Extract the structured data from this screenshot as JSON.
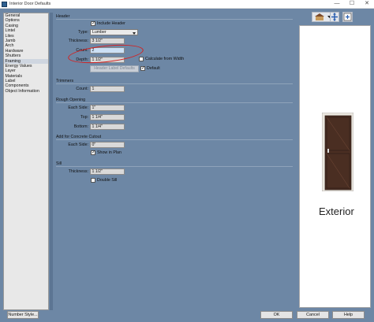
{
  "window": {
    "title": "Interior Door Defaults",
    "minimize": "—",
    "maximize": "☐",
    "close": "✕"
  },
  "sidebar": {
    "items": [
      {
        "label": "General"
      },
      {
        "label": "Options"
      },
      {
        "label": "Casing"
      },
      {
        "label": "Lintel"
      },
      {
        "label": "Lites"
      },
      {
        "label": "Jamb"
      },
      {
        "label": "Arch"
      },
      {
        "label": "Hardware"
      },
      {
        "label": "Shutters"
      },
      {
        "label": "Framing",
        "selected": true
      },
      {
        "label": "Energy Values"
      },
      {
        "label": "Layer"
      },
      {
        "label": "Materials"
      },
      {
        "label": "Label"
      },
      {
        "label": "Components"
      },
      {
        "label": "Object Information"
      }
    ]
  },
  "header": {
    "section_title": "Header",
    "include_header": {
      "label": "Include Header",
      "checked": true
    },
    "type": {
      "label": "Type:",
      "value": "Lumber"
    },
    "thickness": {
      "label": "Thickness:",
      "value": "3 1/2\""
    },
    "count": {
      "label": "Count:",
      "value": "2"
    },
    "depth": {
      "label": "Depth:",
      "value": "1 1/2\""
    },
    "calc_from_width": {
      "label": "Calculate from Width",
      "checked": false
    },
    "label_defaults_button": "Header Label Defaults",
    "default": {
      "label": "Default",
      "checked": true
    }
  },
  "trimmers": {
    "section_title": "Trimmers",
    "count": {
      "label": "Count:",
      "value": "1"
    }
  },
  "rough_opening": {
    "section_title": "Rough Opening",
    "each_side": {
      "label": "Each Side:",
      "value": "1\""
    },
    "top": {
      "label": "Top:",
      "value": "1 1/4\""
    },
    "bottom": {
      "label": "Bottom:",
      "value": "1 1/4\""
    }
  },
  "concrete_cutout": {
    "section_title": "Add for Concrete Cutout",
    "each_side": {
      "label": "Each Side:",
      "value": "0\""
    },
    "show_in_plan": {
      "label": "Show in Plan",
      "checked": true
    }
  },
  "sill": {
    "section_title": "Sill",
    "thickness": {
      "label": "Thickness:",
      "value": "1 1/2\""
    },
    "double_sill": {
      "label": "Double Sill",
      "checked": false
    }
  },
  "preview": {
    "view_label": "Exterior",
    "door_color": "#4a2e22",
    "frame_color": "#ece8e0"
  },
  "buttons": {
    "number_style": "Number Style...",
    "ok": "OK",
    "cancel": "Cancel",
    "help": "Help"
  },
  "colors": {
    "dialog_bg": "#6d87a5",
    "annotation": "#d42020"
  }
}
